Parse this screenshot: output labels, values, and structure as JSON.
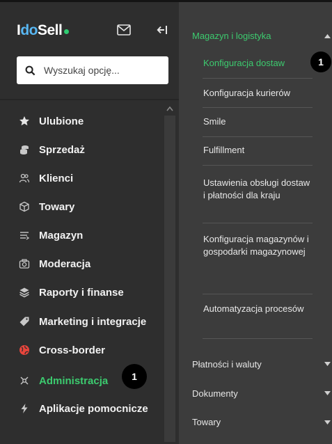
{
  "header": {
    "logo_part1": "I",
    "logo_part2": "do",
    "logo_part3": "Sell"
  },
  "search": {
    "placeholder": "Wyszukaj opcję..."
  },
  "sidebar": {
    "items": [
      {
        "label": "Ulubione",
        "icon": "star-icon"
      },
      {
        "label": "Sprzedaż",
        "icon": "coins-icon"
      },
      {
        "label": "Klienci",
        "icon": "users-icon"
      },
      {
        "label": "Towary",
        "icon": "box-icon"
      },
      {
        "label": "Magazyn",
        "icon": "warehouse-icon"
      },
      {
        "label": "Moderacja",
        "icon": "camera-icon"
      },
      {
        "label": "Raporty i finanse",
        "icon": "layers-icon"
      },
      {
        "label": "Marketing i integracje",
        "icon": "tag-icon"
      },
      {
        "label": "Cross-border",
        "icon": "globe-icon"
      },
      {
        "label": "Administracja",
        "icon": "settings-icon",
        "active": true
      },
      {
        "label": "Aplikacje pomocnicze",
        "icon": "bolt-icon"
      }
    ]
  },
  "submenu": {
    "section_title": "Magazyn i logistyka",
    "items": [
      {
        "label": "Konfiguracja dostaw",
        "active": true
      },
      {
        "label": "Konfiguracja kurierów"
      },
      {
        "label": "Smile"
      },
      {
        "label": "Fulfillment"
      },
      {
        "label": "Ustawienia obsługi dostaw i płatności dla kraju"
      },
      {
        "label": "Konfiguracja magazynów i gospodarki magazynowej"
      },
      {
        "label": "Automatyzacja procesów"
      }
    ],
    "collapsed_sections": [
      {
        "label": "Płatności i waluty"
      },
      {
        "label": "Dokumenty"
      },
      {
        "label": "Towary"
      }
    ]
  },
  "annotations": {
    "badge_1": "1",
    "badge_2": "1"
  },
  "colors": {
    "accent_green": "#3ccb6f",
    "logo_blue": "#58b7f3",
    "cross_border_red": "#e8453c"
  }
}
